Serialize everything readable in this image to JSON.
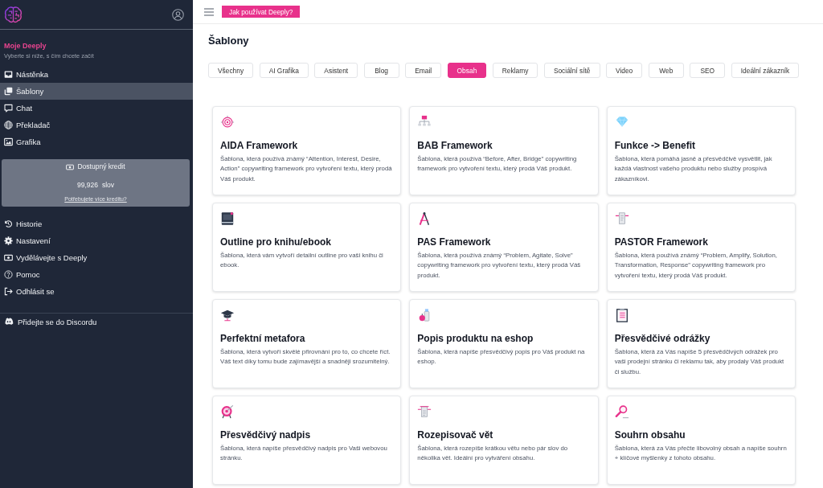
{
  "sidebar": {
    "heading": "Moje Deeply",
    "subtitle": "Vyberte si níže, s čím chcete začít",
    "nav_items": [
      {
        "label": "Nástěnka",
        "selected": false
      },
      {
        "label": "Šablony",
        "selected": true
      },
      {
        "label": "Chat",
        "selected": false
      },
      {
        "label": "Překladač",
        "selected": false
      },
      {
        "label": "Grafika",
        "selected": false
      }
    ],
    "credit": {
      "title": "Dostupný kredit",
      "amount": "99,926",
      "unit": "slov",
      "link": "Potřebujete více kreditu?"
    },
    "account_items": [
      {
        "label": "Historie",
        "selected": false
      },
      {
        "label": "Nastavení",
        "selected": false
      },
      {
        "label": "Vydělávejte s Deeply",
        "selected": false
      },
      {
        "label": "Pomoc",
        "selected": false
      },
      {
        "label": "Odhlásit se",
        "selected": false
      }
    ],
    "community_link": "Přidejte se do Discordu"
  },
  "header": {
    "help_button": "Jak používat Deeply?"
  },
  "page_title": "Šablony",
  "category_tabs": [
    {
      "label": "Všechny",
      "selected": false
    },
    {
      "label": "AI Grafika",
      "selected": false
    },
    {
      "label": "Asistent",
      "selected": false
    },
    {
      "label": "Blog",
      "selected": false
    },
    {
      "label": "Email",
      "selected": false
    },
    {
      "label": "Obsah",
      "selected": true
    },
    {
      "label": "Reklamy",
      "selected": false
    },
    {
      "label": "Sociální sítě",
      "selected": false
    },
    {
      "label": "Video",
      "selected": false
    },
    {
      "label": "Web",
      "selected": false
    },
    {
      "label": "SEO",
      "selected": false
    },
    {
      "label": "Ideální zákazník",
      "selected": false
    }
  ],
  "templates": [
    {
      "title": "AIDA Framework",
      "description": "Šablona, která používá známý “Attention, Interest, Desire, Action” copywriting framework pro vytvoření textu, který prodá Váš produkt."
    },
    {
      "title": "BAB Framework",
      "description": "Šablona, která používá “Before, After, Bridge” copywriting framework pro vytvoření textu, který prodá Váš produkt."
    },
    {
      "title": "Funkce -> Benefit",
      "description": "Šablona, která pomáhá jasně a přesvědčivě vysvětlit, jak každá vlastnost vašeho produktu nebo služby prospívá zákazníkovi."
    },
    {
      "title": "Outline pro knihu/ebook",
      "description": "Šablona, která vám vytvoří detailní outline pro vaši knihu či ebook."
    },
    {
      "title": "PAS Framework",
      "description": "Šablona, která používá známý “Problem, Agitate, Solve” copywriting framework pro vytvoření textu, který prodá Váš produkt."
    },
    {
      "title": "PASTOR Framework",
      "description": "Šablona, která používá známý “Problem, Amplify, Solution, Transformation, Response” copywriting framework pro vytvoření textu, který prodá Váš produkt."
    },
    {
      "title": "Perfektní metafora",
      "description": "Šablona, která vytvoří skvělé přirovnání pro to, co chcete říct. Váš text díky tomu bude zajímavější a snadněji srozumitelný."
    },
    {
      "title": "Popis produktu na eshop",
      "description": "Šablona, která napíše přesvědčivý popis pro Váš produkt na eshop."
    },
    {
      "title": "Přesvědčivé odrážky",
      "description": "Šablona, která za Vás napíše 5 přesvědčivých odrážek pro vaši prodejní stránku či reklamu tak, aby prodaly Váš produkt či službu."
    },
    {
      "title": "Přesvědčivý nadpis",
      "description": "Šablona, která napíše přesvědčivý nadpis pro Vaši webovou stránku."
    },
    {
      "title": "Rozepisovač vět",
      "description": "Šablona, která rozepíše krátkou větu nebo pár slov do několika vět. Ideální pro vytváření obsahu."
    },
    {
      "title": "Souhrn obsahu",
      "description": "Šablona, která za Vás přečte libovolný obsah a napíše souhrn + klíčové myšlenky z tohoto obsahu."
    }
  ]
}
